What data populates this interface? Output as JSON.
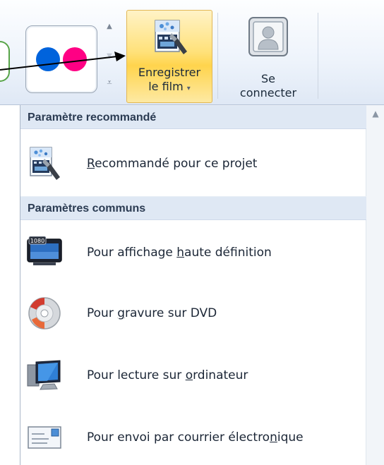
{
  "ribbon": {
    "save_button": {
      "line1": "Enregistrer",
      "line2": "le film",
      "dropdown_glyph": "▾"
    },
    "connect_button": {
      "line1": "Se",
      "line2": "connecter"
    },
    "gallery": {
      "icons": [
        "flickr-icon"
      ]
    },
    "annotation_arrow": "pointer-arrow"
  },
  "menu": {
    "sections": [
      {
        "header": "Paramètre recommandé",
        "items": [
          {
            "pre": "",
            "u": "R",
            "post": "ecommandé pour ce projet",
            "icon": "film-project-icon"
          }
        ]
      },
      {
        "header": "Paramètres communs",
        "items": [
          {
            "pre": "Pour affichage ",
            "u": "h",
            "post": "aute définition",
            "icon": "hd-monitor-icon",
            "badge": "1080"
          },
          {
            "pre": "Pour ",
            "u": "g",
            "post": "ravure sur DVD",
            "icon": "dvd-icon"
          },
          {
            "pre": "Pour lecture sur ",
            "u": "o",
            "post": "rdinateur",
            "icon": "computer-icon"
          },
          {
            "pre": "Pour envoi par courrier électro",
            "u": "n",
            "post": "ique",
            "icon": "email-icon"
          }
        ]
      }
    ]
  },
  "colors": {
    "accent": "#ffd44d",
    "header_bg": "#dfe8f4"
  }
}
